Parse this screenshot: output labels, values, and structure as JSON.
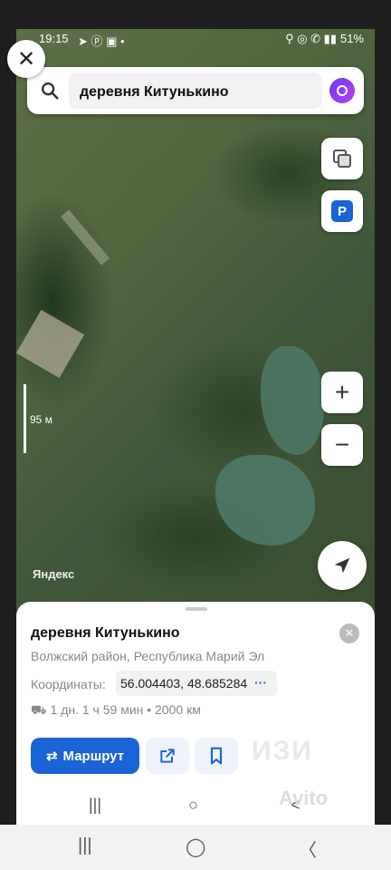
{
  "status_bar": {
    "time": "19:15",
    "icons_left": "➤ ⓟ ▣ •",
    "icons_right": "⚲ ◎ ✆ ▮▮",
    "battery": "51%"
  },
  "search": {
    "value": "деревня Китунькино",
    "icon": "search-icon",
    "assistant_icon": "alice-icon"
  },
  "map": {
    "layers_icon": "layers-icon",
    "parking_label": "P",
    "zoom_in": "+",
    "zoom_out": "−",
    "scale_label": "95 м",
    "brand": "Яндекс",
    "locate_icon": "navigation-arrow-icon"
  },
  "place": {
    "title": "деревня Китунькино",
    "subtitle": "Волжский район, Республика Марий Эл",
    "coords_label": "Координаты:",
    "coords_value": "56.004403, 48.685284",
    "coords_more": "···",
    "route_info": "1 дн. 1 ч 59 мин • 2000 км",
    "route_button": "Маршрут",
    "share_icon": "share-icon",
    "bookmark_icon": "bookmark-icon"
  },
  "watermark": "Avito",
  "inner_nav": {
    "recent": "|||",
    "home": "○",
    "back": "<"
  },
  "system_nav": {
    "recent": "|||",
    "home": "◯",
    "back": "〈"
  },
  "colors": {
    "accent": "#1a64d6",
    "alice": "#8b3ff0"
  }
}
